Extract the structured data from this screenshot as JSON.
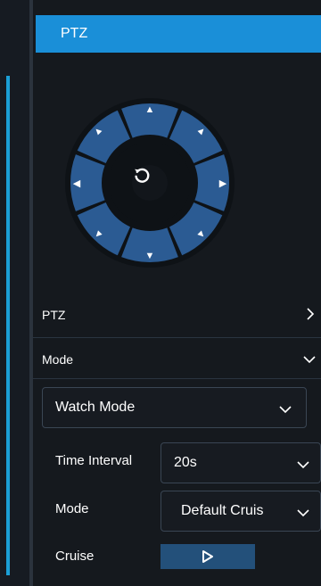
{
  "panel": {
    "title": "PTZ"
  },
  "joystick": {
    "icons": {
      "up": "arrow-up-icon",
      "down": "arrow-down-icon",
      "left": "arrow-left-icon",
      "right": "arrow-right-icon",
      "up_left": "arrow-up-left-icon",
      "up_right": "arrow-up-right-icon",
      "down_left": "arrow-down-left-icon",
      "down_right": "arrow-down-right-icon",
      "center": "reset-icon"
    }
  },
  "sections": {
    "ptz_label": "PTZ",
    "mode_label": "Mode"
  },
  "mode_select": {
    "value": "Watch Mode"
  },
  "fields": {
    "time_interval_label": "Time Interval",
    "time_interval_value": "20s",
    "mode_label": "Mode",
    "mode_value": "Default Cruis",
    "cruise_label": "Cruise"
  },
  "colors": {
    "header": "#1a8fd8",
    "joystick_segment": "#2b5b93",
    "play_button": "#23507a",
    "accent": "#1b9fd6"
  }
}
